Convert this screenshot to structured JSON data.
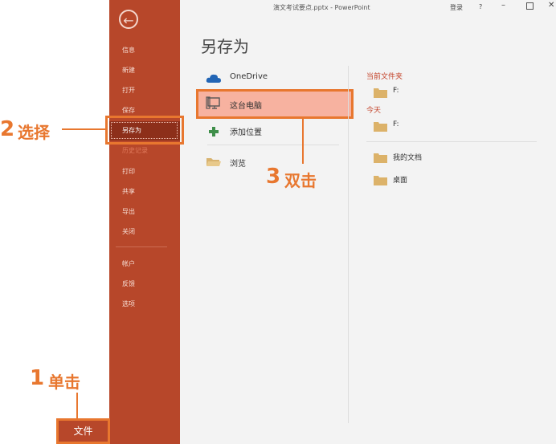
{
  "window": {
    "title": "演文考试要点.pptx  -  PowerPoint",
    "login": "登录",
    "help": "?",
    "minimize": "–",
    "close": "✕"
  },
  "backstage": {
    "back_icon": "←",
    "menu": {
      "info": "信息",
      "new": "新建",
      "open": "打开",
      "save": "保存",
      "save_as": "另存为",
      "history": "历史记录",
      "print": "打印",
      "share": "共享",
      "export": "导出",
      "close": "关闭",
      "account": "帐户",
      "feedback": "反馈",
      "options": "选项"
    },
    "file_tab": "文件"
  },
  "main": {
    "page_title": "另存为",
    "locations": {
      "onedrive": "OneDrive",
      "this_pc": "这台电脑",
      "add_place": "添加位置",
      "browse": "浏览"
    },
    "current_folder_heading": "当前文件夹",
    "current_folder": "F:",
    "today_heading": "今天",
    "today_folder": "F:",
    "documents": "我的文档",
    "desktop": "桌面"
  },
  "annotations": {
    "step1_number": "1",
    "step1_text": "单击",
    "step2_number": "2",
    "step2_text": "选择",
    "step3_number": "3",
    "step3_text": "双击"
  },
  "colors": {
    "backstage": "#b7472a",
    "highlight": "#f7b2a0",
    "annotation": "#e8772f"
  }
}
